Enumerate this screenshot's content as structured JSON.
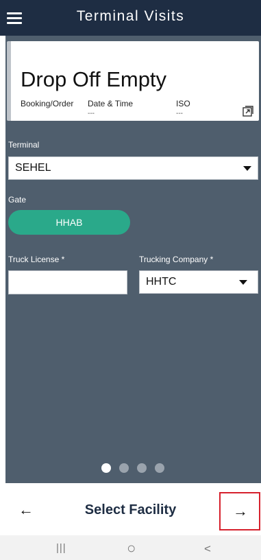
{
  "header": {
    "title": "Terminal Visits",
    "menu_icon": "hamburger-menu-icon"
  },
  "card": {
    "title": "Drop Off Empty",
    "fields": [
      {
        "label": "Booking/Order",
        "value": ""
      },
      {
        "label": "Date & Time",
        "value": "---"
      },
      {
        "label": "ISO",
        "value": "---"
      }
    ],
    "expand_icon": "expand-icon"
  },
  "form": {
    "terminal": {
      "label": "Terminal",
      "value": "SEHEL"
    },
    "gate": {
      "label": "Gate",
      "value": "HHAB"
    },
    "truck_license": {
      "label": "Truck License *",
      "value": "",
      "placeholder": ""
    },
    "trucking_company": {
      "label": "Trucking Company *",
      "value": "HHTC"
    }
  },
  "pager": {
    "total": 4,
    "active": 0
  },
  "footer": {
    "back_icon": "arrow-left-icon",
    "title": "Select Facility",
    "next_icon": "arrow-right-icon"
  },
  "system_nav": {
    "recents": "|||",
    "home": "○",
    "back": "<"
  },
  "colors": {
    "header_bg": "#1e2d43",
    "panel_bg": "#4f5e6d",
    "gate_pill": "#2aa98a",
    "highlight": "#d6202c"
  }
}
